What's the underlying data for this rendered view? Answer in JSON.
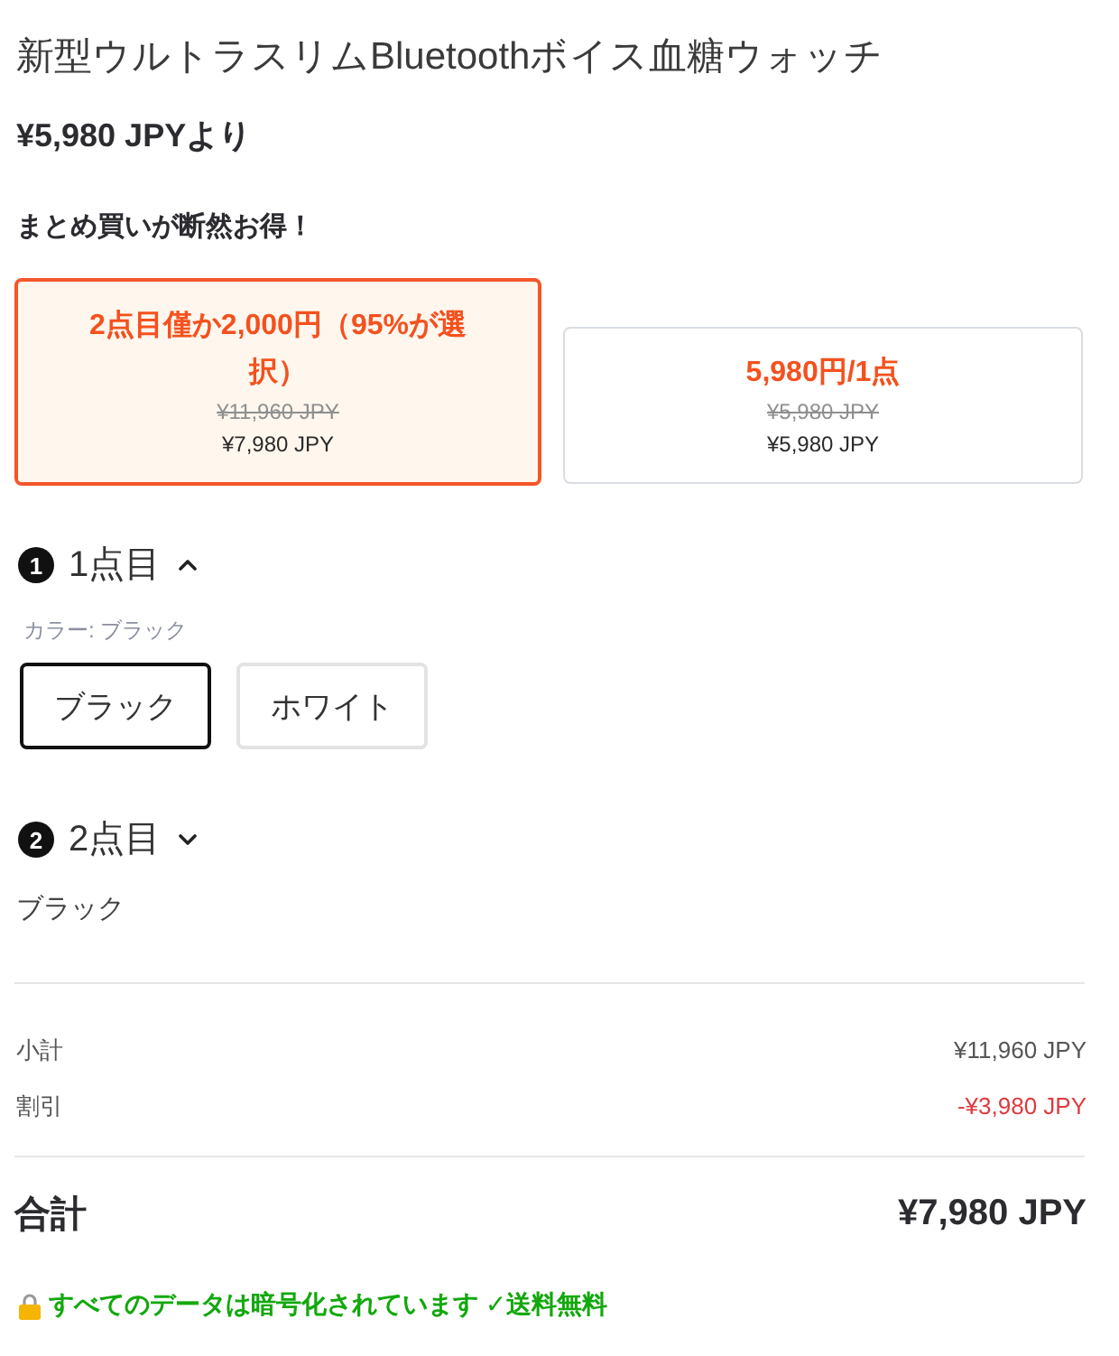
{
  "product": {
    "title": "新型ウルトラスリムBluetoothボイス血糖ウォッチ",
    "price_from": "¥5,980 JPYより"
  },
  "bundle": {
    "heading": "まとめ買いが断然お得！",
    "offers": [
      {
        "title": "2点目僅か2,000円（95%が選択）",
        "original_price": "¥11,960 JPY",
        "price": "¥7,980 JPY",
        "selected": true
      },
      {
        "title": "5,980円/1点",
        "original_price": "¥5,980 JPY",
        "price": "¥5,980 JPY",
        "selected": false
      }
    ]
  },
  "items": [
    {
      "number": "1",
      "label": "1点目",
      "expanded": true,
      "color_label": "カラー: ブラック",
      "options": [
        {
          "label": "ブラック",
          "selected": true
        },
        {
          "label": "ホワイト",
          "selected": false
        }
      ]
    },
    {
      "number": "2",
      "label": "2点目",
      "expanded": false,
      "summary": "ブラック"
    }
  ],
  "summary": {
    "rows": [
      {
        "kind": "normal",
        "label": "小計",
        "value": "¥11,960 JPY"
      },
      {
        "kind": "discount",
        "label": "割引",
        "value": "-¥3,980 JPY"
      }
    ],
    "total_label": "合計",
    "total_value": "¥7,980 JPY"
  },
  "footer": {
    "note": "すべてのデータは暗号化されています ✓送料無料"
  }
}
